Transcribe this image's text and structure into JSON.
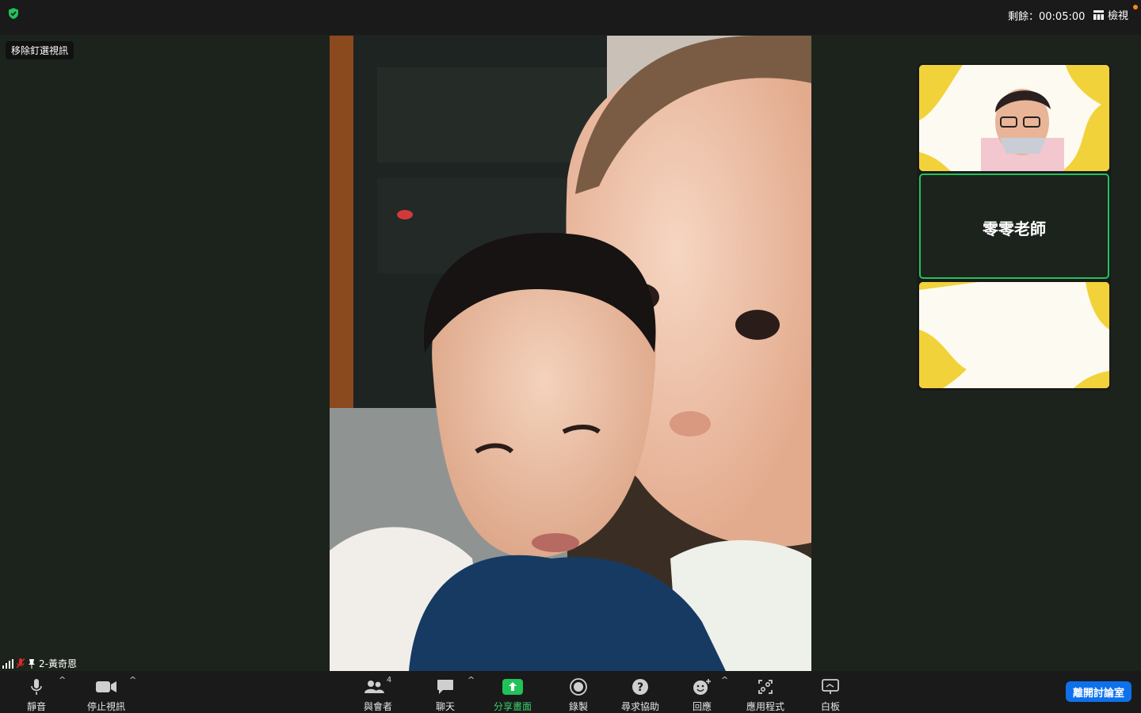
{
  "topbar": {
    "timer": "剩餘：00:05:00",
    "view_label": "檢視"
  },
  "main": {
    "unpin_label": "移除釘選視訊",
    "participant_name": "2-黃奇恩"
  },
  "thumbnails": {
    "second_name": "零零老師"
  },
  "toolbar": {
    "mute": "靜音",
    "stop_video": "停止視訊",
    "participants": "與會者",
    "participants_count": "4",
    "chat": "聊天",
    "share_screen": "分享畫面",
    "record": "錄製",
    "ask_help": "尋求協助",
    "reactions": "回應",
    "apps": "應用程式",
    "whiteboard": "白板",
    "leave": "離開討論室"
  },
  "colors": {
    "accent_green": "#21c25a",
    "leave_blue": "#0e71eb",
    "thumb_yellow": "#f2d23a"
  },
  "icons": [
    "shield-icon",
    "grid-view-icon",
    "signal-icon",
    "mic-muted-icon",
    "pin-icon",
    "mic-icon",
    "video-camera-icon",
    "participants-icon",
    "chat-icon",
    "share-screen-icon",
    "record-icon",
    "help-icon",
    "reactions-icon",
    "apps-icon",
    "whiteboard-icon"
  ]
}
